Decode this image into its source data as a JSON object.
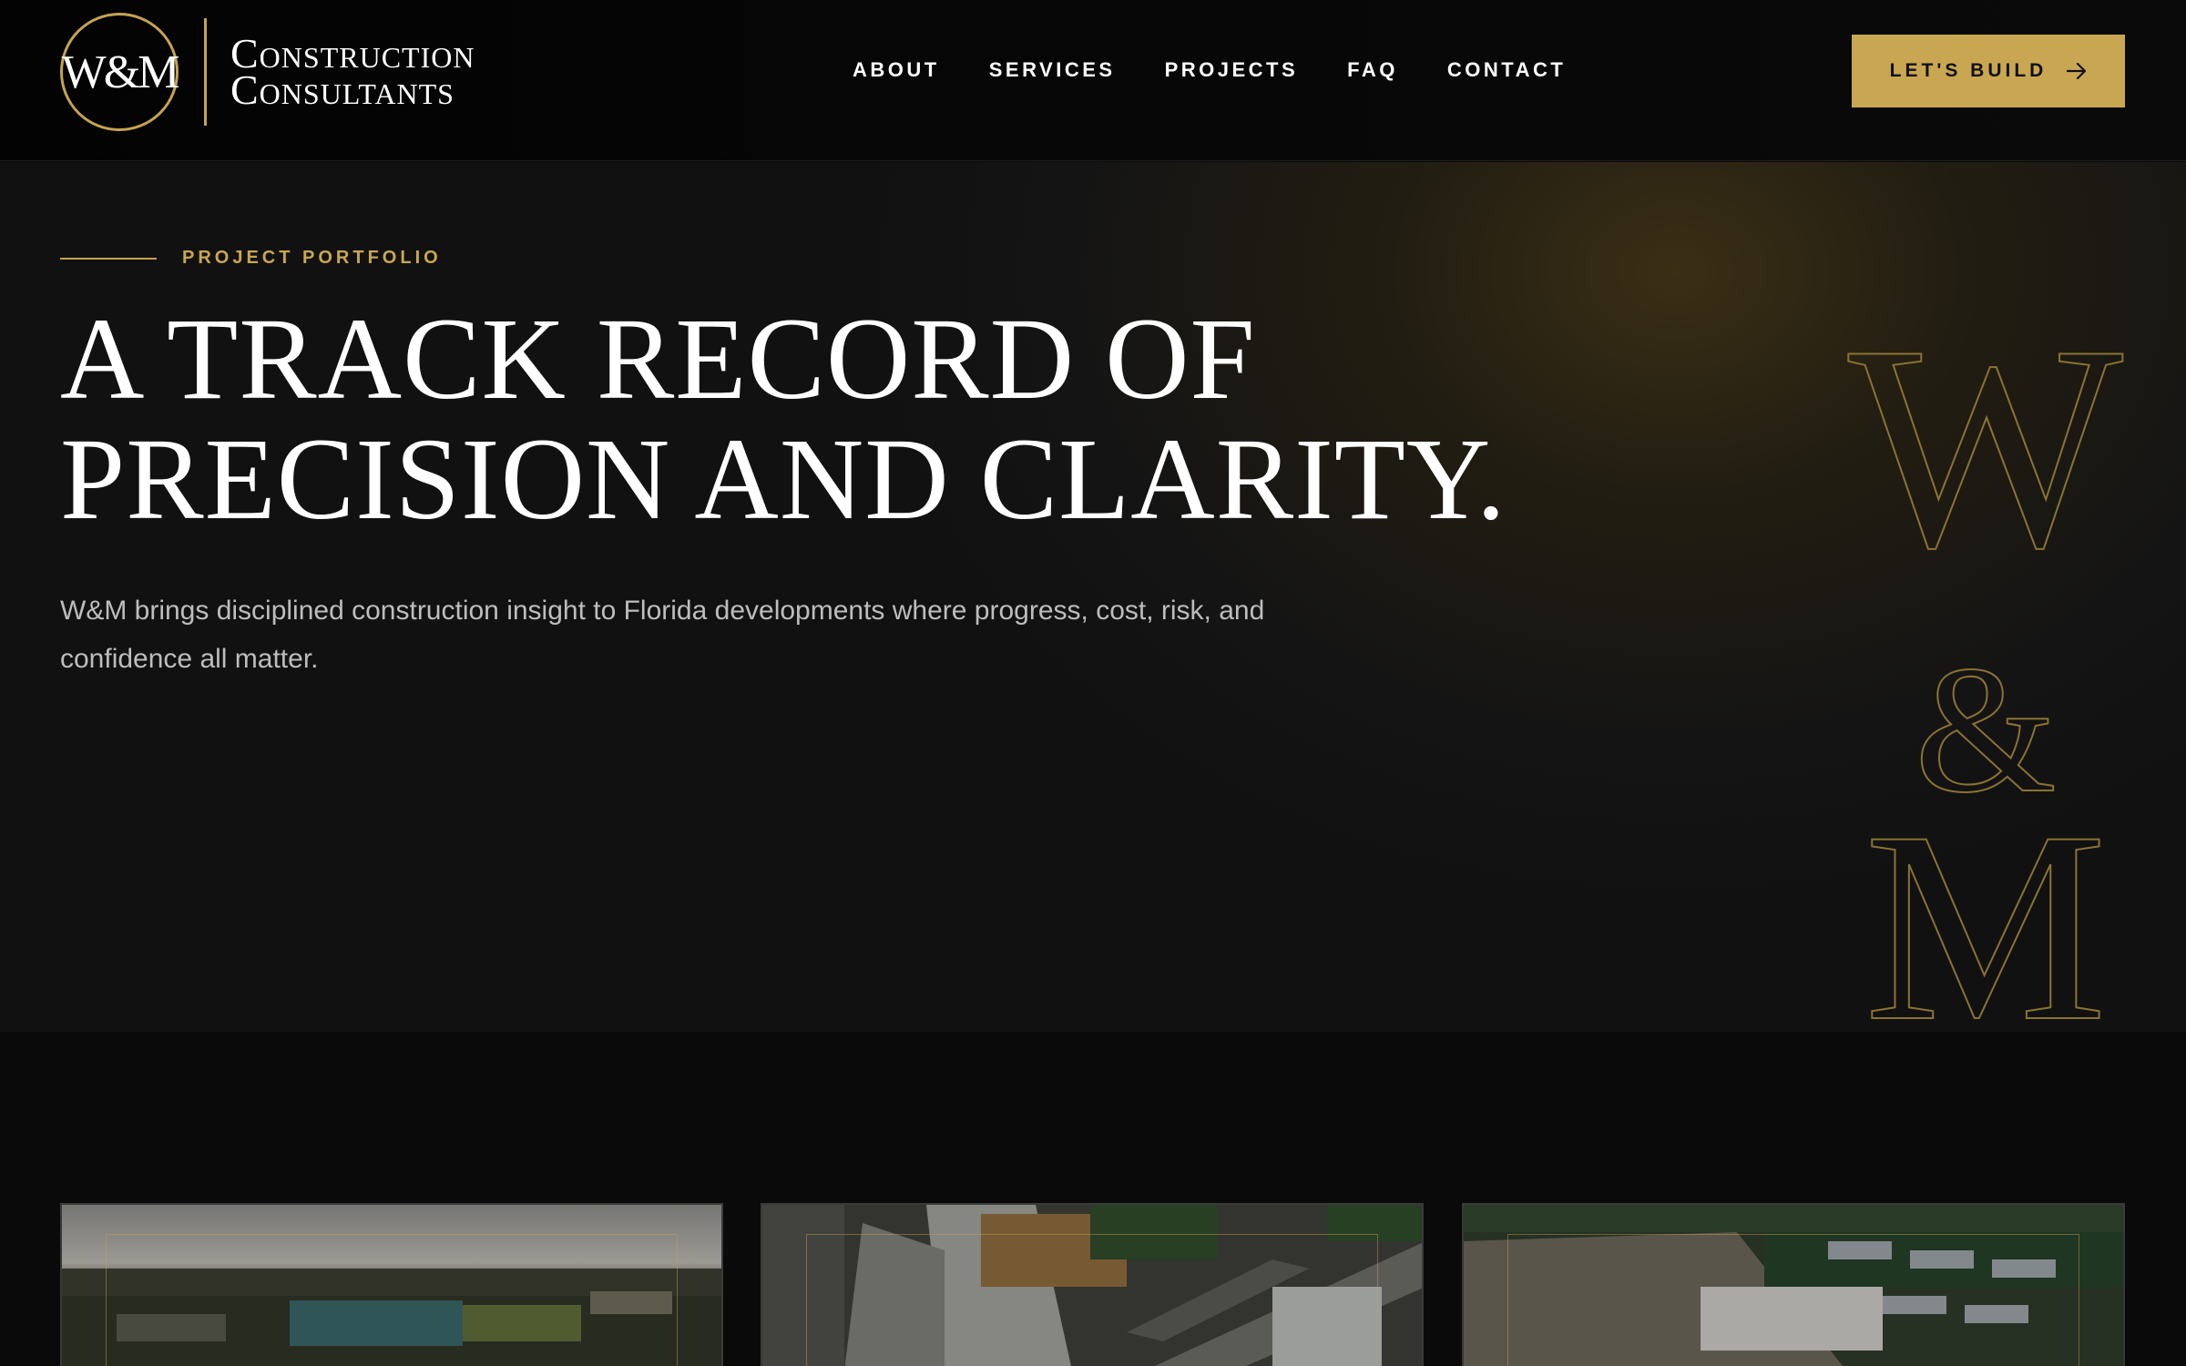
{
  "brand": {
    "mark": "W&M",
    "name_line1": "Construction",
    "name_line2": "Consultants",
    "accent_color": "#c9a752"
  },
  "nav": {
    "items": [
      "ABOUT",
      "SERVICES",
      "PROJECTS",
      "FAQ",
      "CONTACT"
    ]
  },
  "cta": {
    "label": "LET'S BUILD",
    "icon": "arrow-right-icon"
  },
  "hero": {
    "eyebrow": "PROJECT PORTFOLIO",
    "title_line1": "A TRACK RECORD OF",
    "title_line2": "PRECISION AND CLARITY.",
    "subtitle": "W&M brings disciplined construction insight to Florida developments where progress, cost, risk, and confidence all matter.",
    "monogram": "W&M"
  },
  "projects": {
    "cards": [
      {
        "image": "aerial-coastal-development-photo"
      },
      {
        "image": "aerial-urban-construction-photo"
      },
      {
        "image": "aerial-residential-site-photo"
      }
    ]
  }
}
